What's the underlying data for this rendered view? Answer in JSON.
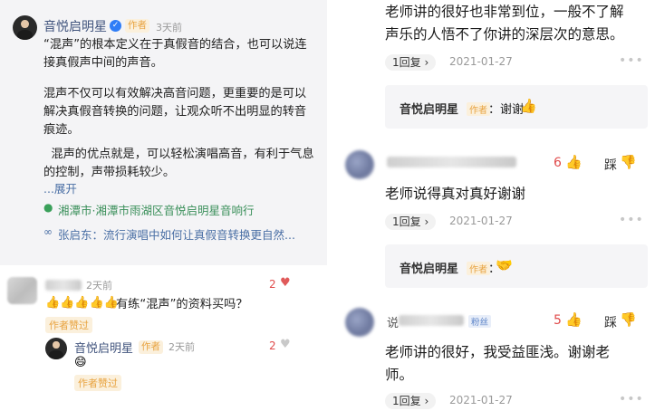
{
  "left": {
    "main_comment": {
      "author": "音悦启明星",
      "author_tag": "作者",
      "time": "3天前",
      "paragraphs": [
        "“混声”的根本定义在于真假音的结合，也可以说连",
        "接真假声中间的声音。",
        "混声不仅可以有效解决高音问题，更重要的是可以",
        "解决真假音转换的问题，让观众听不出明显的转音",
        "痕迹。",
        "  混声的优点就是，可以轻松演唱高音，有利于气息",
        "的控制，声带损耗较少。"
      ],
      "expand_label": "...展开",
      "location": "湘潭市·湘潭市雨湖区音悦启明星音响行",
      "related": "张启东：流行演唱中如何让真假音转换更自然..."
    },
    "comment2": {
      "time": "2天前",
      "text": "有练“混声”的资料买吗？",
      "likes": "2",
      "author_liked": "作者赞过",
      "reply": {
        "author": "音悦启明星",
        "author_tag": "作者",
        "time": "2天前",
        "likes": "2",
        "author_liked": "作者赞过"
      }
    }
  },
  "right": {
    "comment1": {
      "text_line1": "老师讲的很好也非常到位，一般不了解",
      "text_line2": "声乐的人悟不了你讲的深层次的意思。",
      "reply_label": "1回复",
      "date": "2021-01-27",
      "author_reply": {
        "name": "音悦启明星",
        "tag": "作者",
        "text": "：谢谢"
      }
    },
    "comment2": {
      "likes": "6",
      "dislike_label": "踩",
      "text": "老师说得真对真好谢谢",
      "reply_label": "1回复",
      "date": "2021-01-27",
      "author_reply": {
        "name": "音悦启明星",
        "tag": "作者",
        "text": "："
      }
    },
    "comment3": {
      "name_prefix": "说",
      "fans_tag": "粉丝",
      "likes": "5",
      "dislike_label": "踩",
      "text_line1": "老师讲的很好，我受益匪浅。谢谢老",
      "text_line2": "师。",
      "reply_label": "1回复",
      "date": "2021-01-27"
    }
  },
  "icons": {
    "thumb": "👍",
    "handshake": "🤝",
    "smile_emoji": "😄",
    "heart": "♥",
    "location": "📍",
    "link": "🔗"
  }
}
